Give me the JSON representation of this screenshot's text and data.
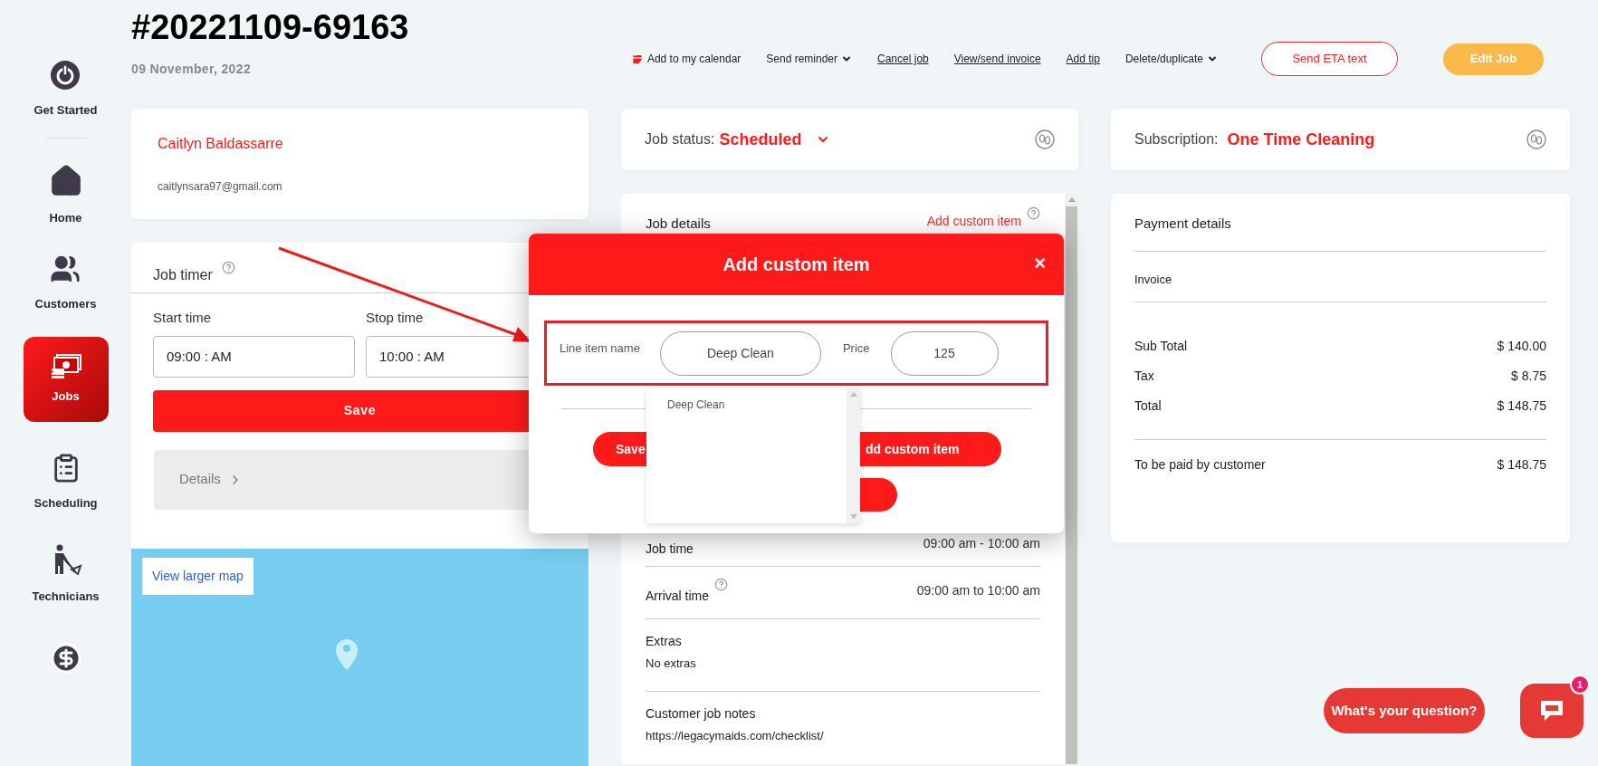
{
  "header": {
    "title": "#20221109-69163",
    "date": "09 November, 2022"
  },
  "sidebar": {
    "items": [
      {
        "label": "Get Started",
        "selected": false
      },
      {
        "label": "Home",
        "selected": false
      },
      {
        "label": "Customers",
        "selected": false
      },
      {
        "label": "Jobs",
        "selected": true
      },
      {
        "label": "Scheduling",
        "selected": false
      },
      {
        "label": "Technicians",
        "selected": false
      },
      {
        "selected": false
      }
    ]
  },
  "actions": [
    {
      "label": "Add to my calendar",
      "kind": "icon-link"
    },
    {
      "label": "Send reminder",
      "kind": "dropdown"
    },
    {
      "label": "Cancel job",
      "kind": "link"
    },
    {
      "label": "View/send invoice",
      "kind": "link"
    },
    {
      "label": "Add tip",
      "kind": "link"
    },
    {
      "label": "Delete/duplicate",
      "kind": "dropdown"
    },
    {
      "label": "Send ETA text",
      "kind": "outline-button"
    },
    {
      "label": "Edit Job",
      "kind": "primary-button"
    }
  ],
  "customer": {
    "name": "Caitlyn Baldassarre",
    "email": "caitlynsara97@gmail.com"
  },
  "job_timer": {
    "title": "Job timer",
    "start_label": "Start time",
    "start_value": "09:00 : AM",
    "stop_label": "Stop time",
    "stop_value": "10:00 : AM",
    "save": "Save",
    "details": "Details"
  },
  "map": {
    "link": "View larger map"
  },
  "job_status": {
    "label": "Job status:",
    "value": "Scheduled"
  },
  "job_details": {
    "title": "Job details",
    "link": "Add custom item",
    "rows": [
      {
        "label": "Job time",
        "value": "09:00 am - 10:00 am",
        "help": false
      },
      {
        "label": "Arrival time",
        "value": "09:00 am to 10:00 am",
        "help": true
      }
    ],
    "sections": [
      {
        "label": "Extras",
        "value": "No extras"
      },
      {
        "label": "Customer job notes",
        "value": "https://legacymaids.com/checklist/"
      }
    ]
  },
  "subscription": {
    "label": "Subscription:",
    "value": "One Time Cleaning"
  },
  "payment": {
    "title": "Payment details",
    "invoice": "Invoice",
    "lines": [
      {
        "label": "Sub Total",
        "value": "$ 140.00"
      },
      {
        "label": "Tax",
        "value": "$ 8.75"
      },
      {
        "label": "Total",
        "value": "$ 148.75"
      }
    ],
    "due": {
      "label": "To be paid by customer",
      "value": "$ 148.75"
    }
  },
  "modal": {
    "title": "Add custom item",
    "close": "×",
    "line_item_label": "Line item name",
    "line_item_value": "Deep Clean",
    "price_label": "Price",
    "price_value": "125",
    "save": "Save",
    "add": "dd custom item",
    "suggestions": [
      "Deep Clean"
    ]
  },
  "chat": {
    "prompt": "What's your question?",
    "badge": "1"
  }
}
